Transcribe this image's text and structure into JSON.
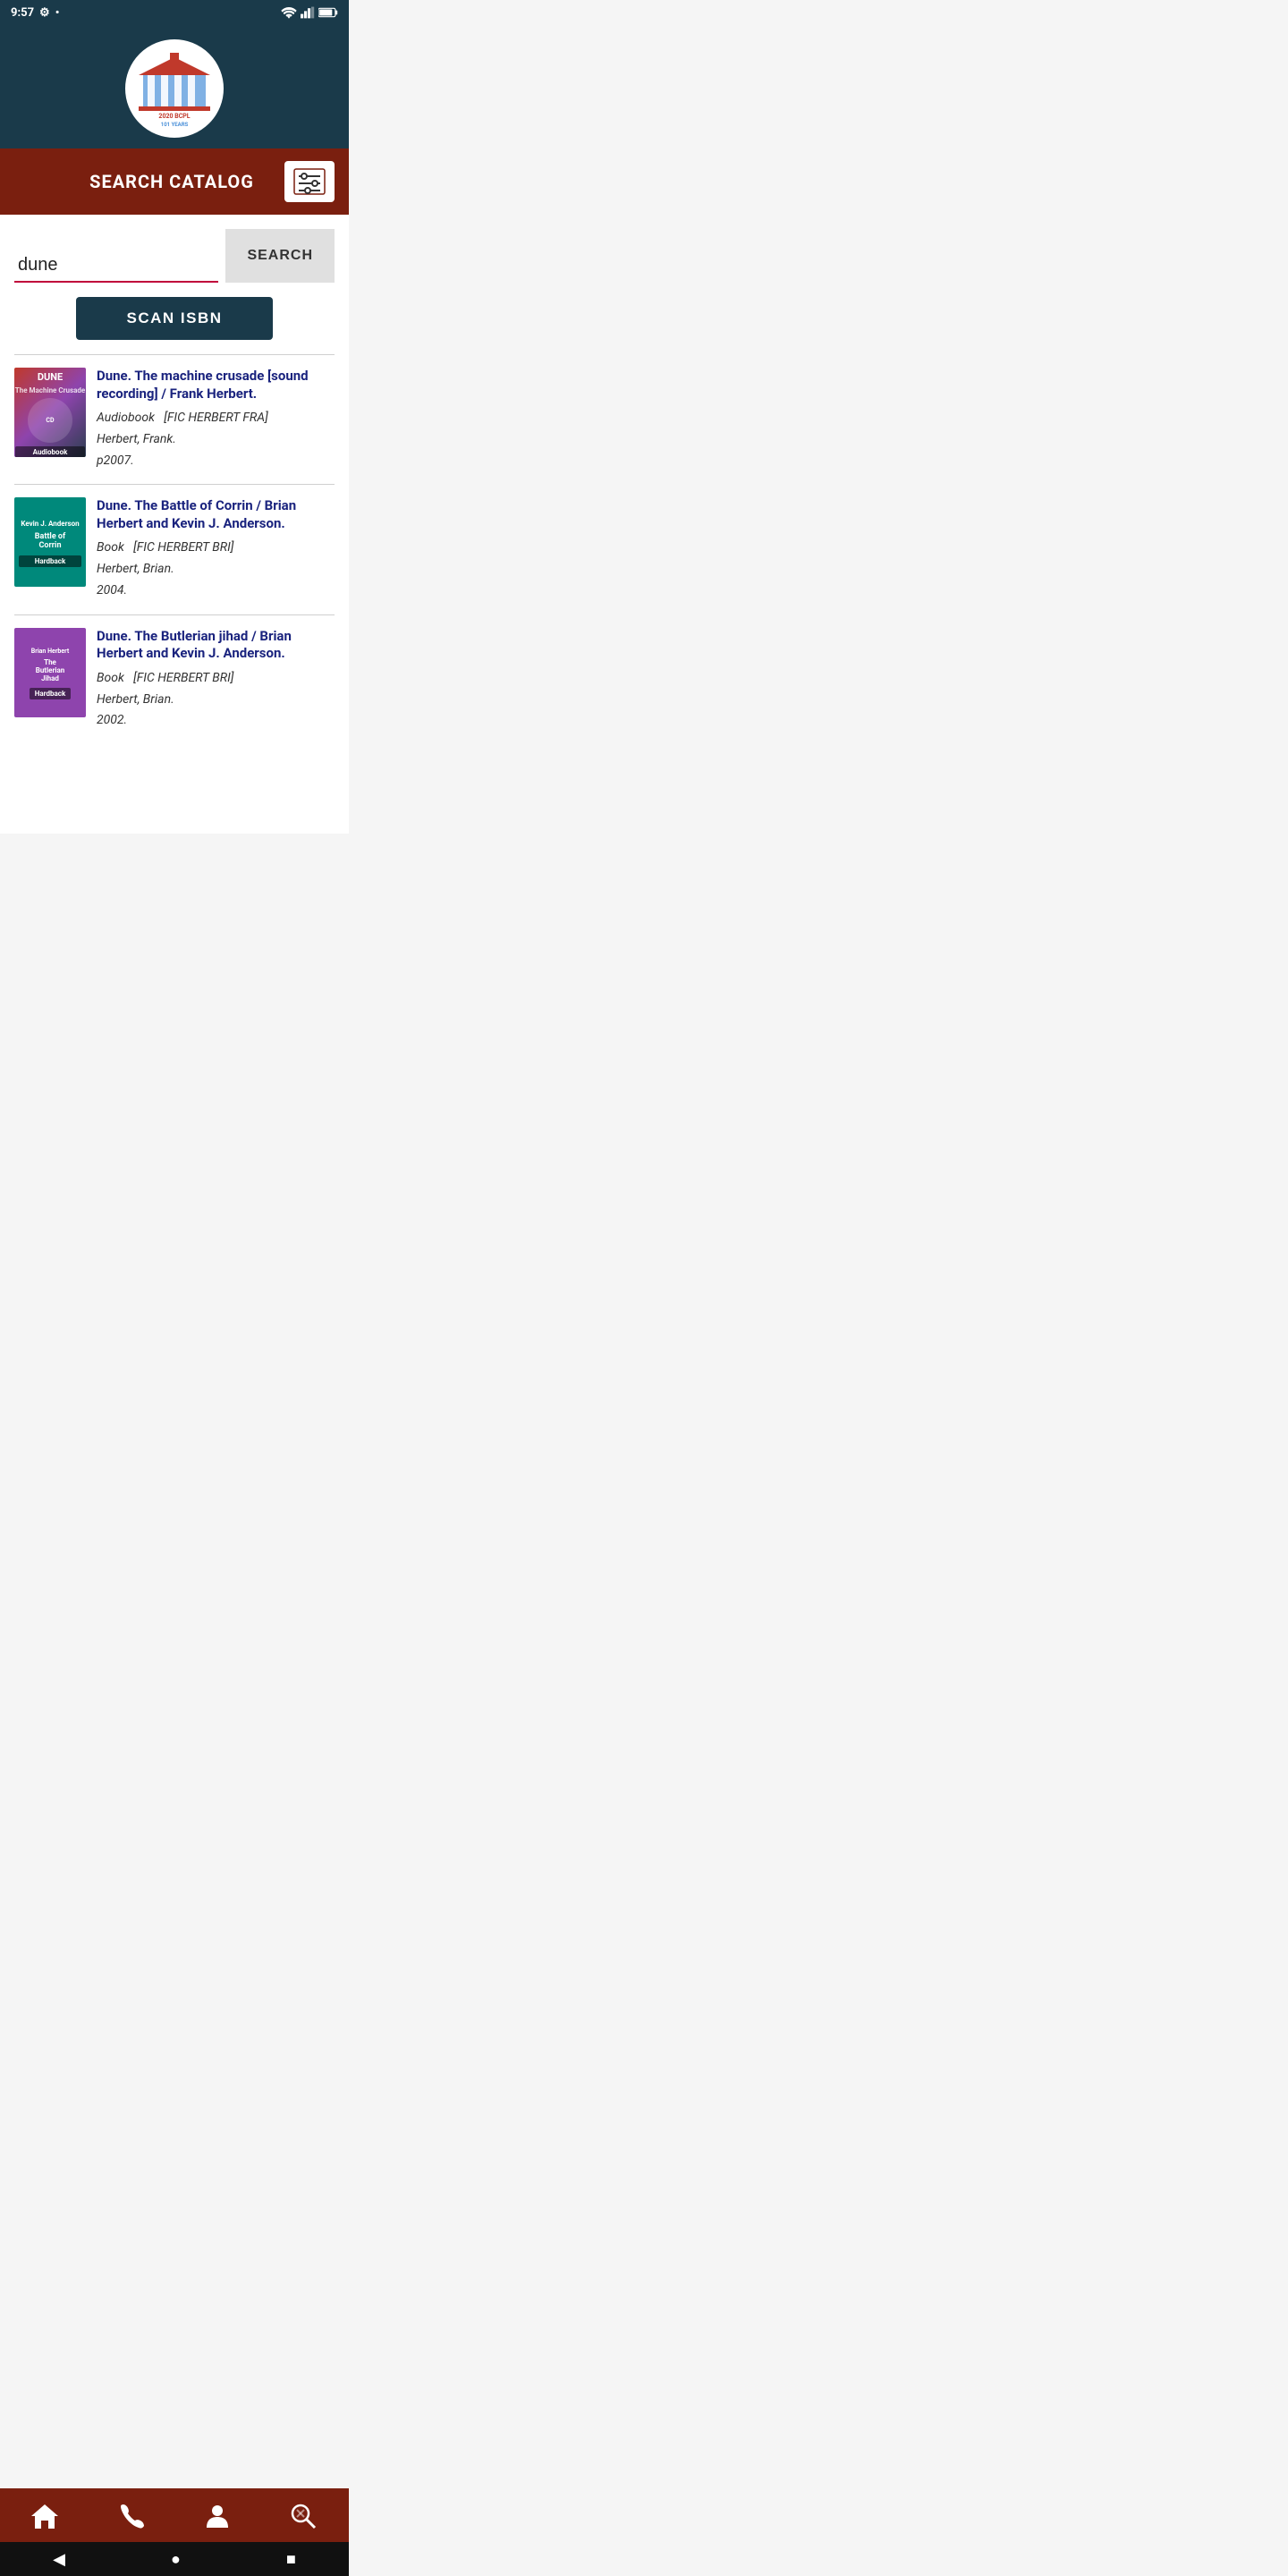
{
  "status_bar": {
    "time": "9:57",
    "settings_icon": "gear-icon",
    "dot": "•"
  },
  "header": {
    "logo_alt": "2020 BCPL 101 Years Library Logo"
  },
  "toolbar": {
    "title": "SEARCH CATALOG",
    "filter_icon": "filter-icon"
  },
  "search": {
    "input_value": "dune",
    "input_placeholder": "",
    "search_button_label": "SEARCH"
  },
  "scan_isbn": {
    "label": "SCAN ISBN"
  },
  "results": [
    {
      "title": "Dune. The machine crusade [sound recording] / Frank Herbert.",
      "type": "Audiobook",
      "call_number": "[FIC HERBERT FRA]",
      "author": "Herbert, Frank.",
      "year": "p2007.",
      "cover_style": "cover-dune",
      "cover_text": "DUNE"
    },
    {
      "title": "Dune. The Battle of Corrin / Brian Herbert and Kevin J. Anderson.",
      "type": "Book",
      "call_number": "[FIC HERBERT BRI]",
      "author": "Herbert, Brian.",
      "year": "2004.",
      "cover_style": "cover-battle",
      "cover_text": "Battle of Corrin"
    },
    {
      "title": "Dune. The Butlerian jihad / Brian Herbert and Kevin J. Anderson.",
      "type": "Book",
      "call_number": "[FIC HERBERT BRI]",
      "author": "Herbert, Brian.",
      "year": "2002.",
      "cover_style": "cover-butlerian",
      "cover_text": "The Butlerian Jihad"
    }
  ],
  "bottom_nav": [
    {
      "name": "home-nav",
      "icon": "home-icon",
      "label": "Home"
    },
    {
      "name": "phone-nav",
      "icon": "phone-icon",
      "label": "Phone"
    },
    {
      "name": "account-nav",
      "icon": "person-icon",
      "label": "Account"
    },
    {
      "name": "catalog-nav",
      "icon": "catalog-icon",
      "label": "Catalog"
    }
  ],
  "android_nav": {
    "back": "◀",
    "home": "●",
    "recent": "■"
  }
}
